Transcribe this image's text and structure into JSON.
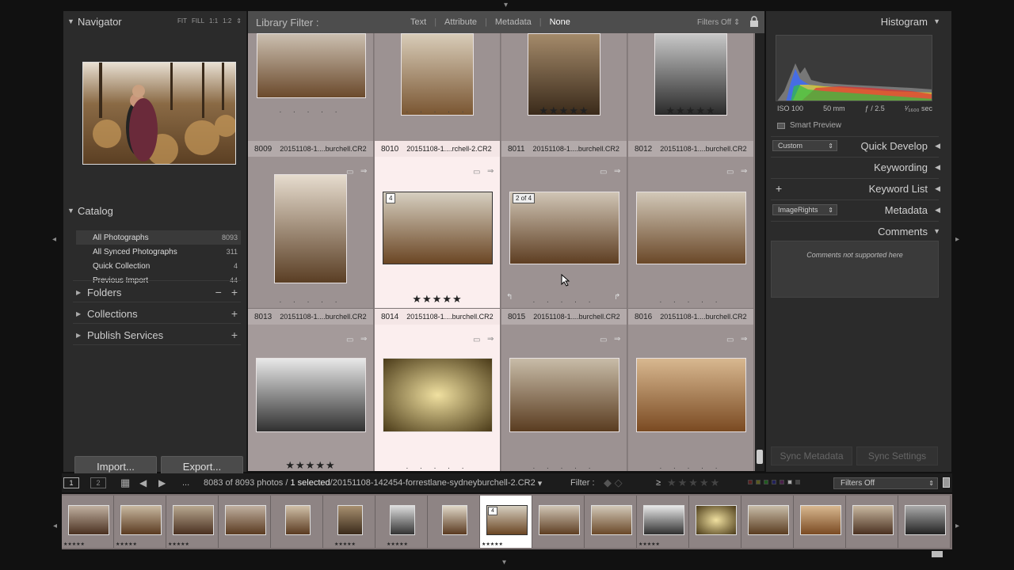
{
  "navigator": {
    "title": "Navigator",
    "controls": [
      "FIT",
      "FILL",
      "1:1",
      "1:2"
    ]
  },
  "catalog": {
    "title": "Catalog",
    "items": [
      {
        "label": "All Photographs",
        "count": "8093"
      },
      {
        "label": "All Synced Photographs",
        "count": "311"
      },
      {
        "label": "Quick Collection",
        "count": "4"
      },
      {
        "label": "Previous Import",
        "count": "44"
      }
    ]
  },
  "sections": {
    "folders": "Folders",
    "collections": "Collections",
    "publish": "Publish Services"
  },
  "buttons": {
    "import": "Import...",
    "export": "Export..."
  },
  "filter_bar": {
    "title": "Library Filter :",
    "options": [
      "Text",
      "Attribute",
      "Metadata",
      "None"
    ],
    "active": "None",
    "filters_off": "Filters Off"
  },
  "grid": {
    "row1": [
      {
        "num": "8009",
        "file": "20151108-1....burchell.CR2",
        "rating": ". . . . ."
      },
      {
        "num": "8010",
        "file": "20151108-1....rchell-2.CR2",
        "rating": ". . . . ."
      },
      {
        "num": "8011",
        "file": "20151108-1....burchell.CR2",
        "rating": "★★★★★"
      },
      {
        "num": "8012",
        "file": "20151108-1....burchell.CR2",
        "rating": "★★★★★"
      }
    ],
    "row2": [
      {
        "num": "8013",
        "file": "20151108-1....burchell.CR2",
        "rating": ". . . . ."
      },
      {
        "num": "8014",
        "file": "20151108-1....burchell.CR2",
        "rating": "★★★★★",
        "badge": "4"
      },
      {
        "num": "8015",
        "file": "20151108-1....burchell.CR2",
        "rating": ". . . . .",
        "badge": "2 of 4"
      },
      {
        "num": "8016",
        "file": "20151108-1....burchell.CR2",
        "rating": ". . . . ."
      }
    ],
    "row3": [
      {
        "rating": "★★★★★"
      },
      {
        "rating": ". . . . ."
      },
      {
        "rating": ". . . . ."
      },
      {
        "rating": ". . . . ."
      }
    ]
  },
  "right_panel": {
    "histogram": "Histogram",
    "iso": "ISO 100",
    "focal": "50 mm",
    "aperture": "ƒ / 2.5",
    "shutter": "¹⁄₁₆₀₀ sec",
    "smart_preview": "Smart Preview",
    "quick_develop_preset": "Custom",
    "quick_develop": "Quick Develop",
    "keywording": "Keywording",
    "keyword_list": "Keyword List",
    "metadata_preset": "ImageRights",
    "metadata": "Metadata",
    "comments": "Comments",
    "comments_note": "Comments not supported here",
    "sync_metadata": "Sync Metadata",
    "sync_settings": "Sync Settings"
  },
  "toolbar": {
    "page1": "1",
    "page2": "2",
    "ellipsis": "...",
    "count": "8083 of 8093 photos /",
    "selected": "1 selected",
    "path": "/20151108-142454-forrestlane-sydneyburchell-2.CR2",
    "filter_label": "Filter :",
    "filters_off": "Filters Off",
    "gte": "≥"
  },
  "filmstrip": {
    "selected_badge": "4",
    "stars": "★★★★★"
  },
  "colors": {
    "panel": "#2b2b2b",
    "grid_bg": "#9c9292",
    "selected_cell": "#fbeeee",
    "accent_text": "#d0d0d0"
  }
}
